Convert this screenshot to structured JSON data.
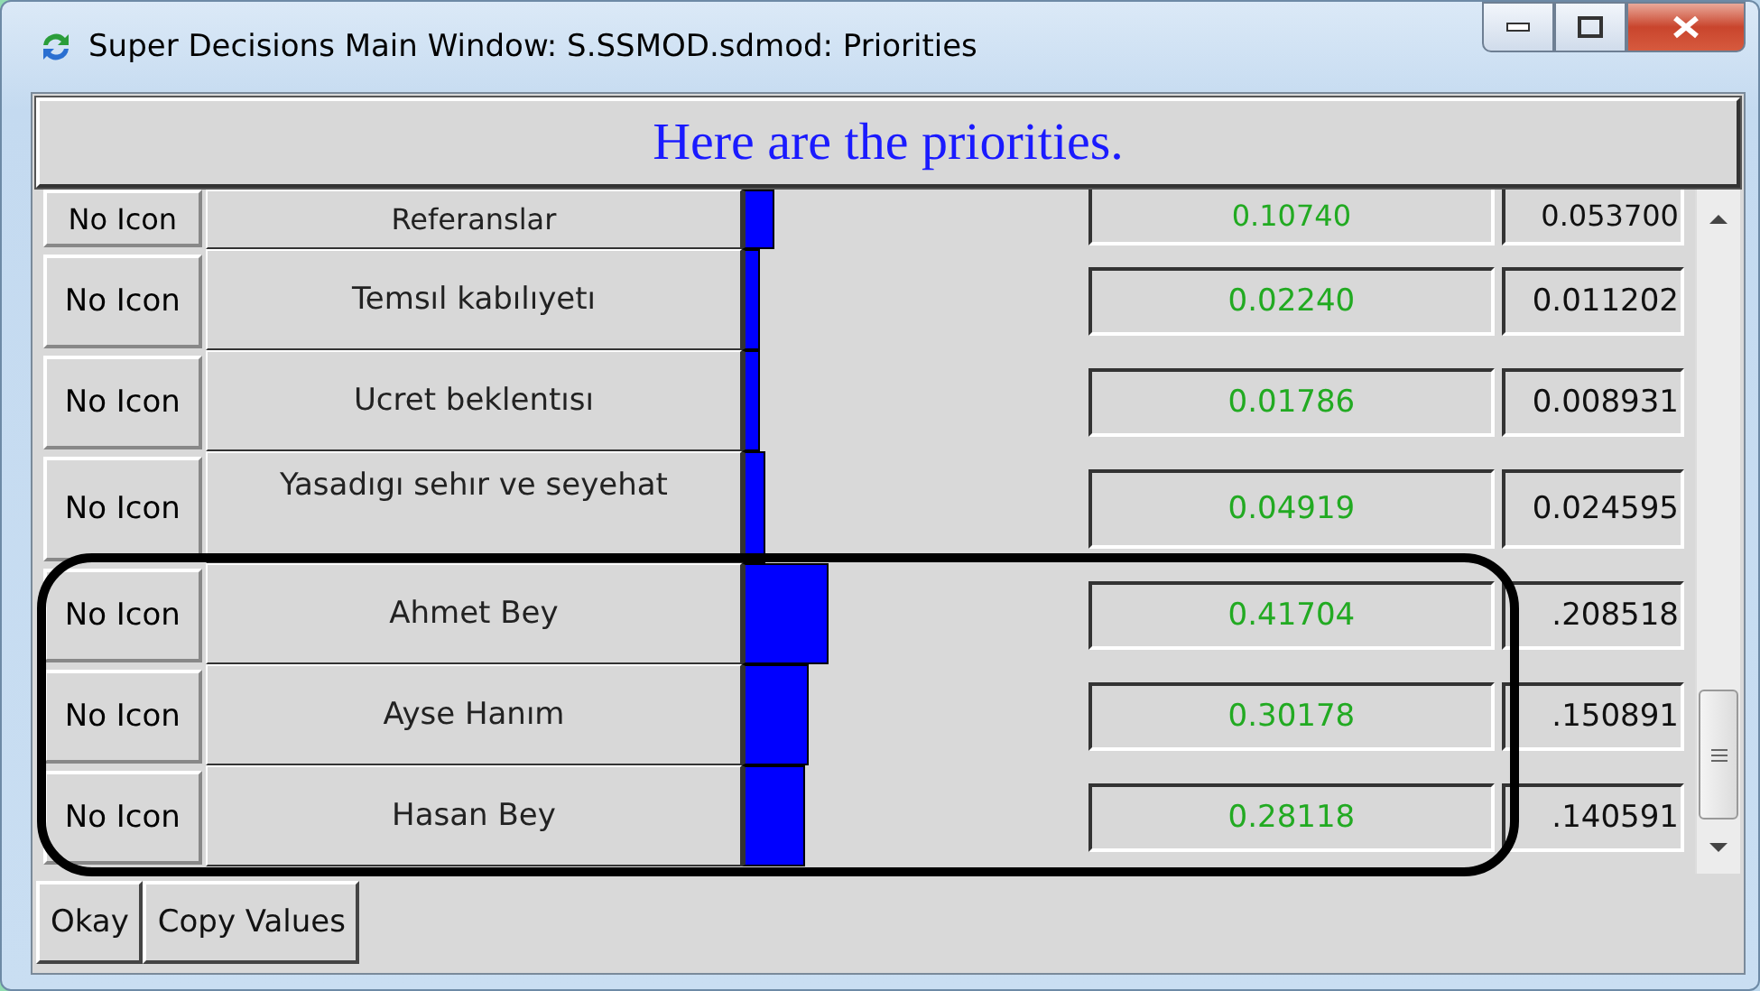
{
  "window": {
    "title": "Super Decisions Main Window: S.SSMOD.sdmod: Priorities"
  },
  "header": "Here are the priorities.",
  "rows": [
    {
      "icon": "No Icon",
      "name": "Referanslar",
      "value": "0.10740",
      "normalized": "0.053700"
    },
    {
      "icon": "No Icon",
      "name": "Temsıl kabılıyetı",
      "value": "0.02240",
      "normalized": "0.011202"
    },
    {
      "icon": "No Icon",
      "name": "Ucret beklentısı",
      "value": "0.01786",
      "normalized": "0.008931"
    },
    {
      "icon": "No Icon",
      "name": "Yasadıgı sehır ve seyehat",
      "value": "0.04919",
      "normalized": "0.024595"
    },
    {
      "icon": "No Icon",
      "name": "Ahmet Bey",
      "value": "0.41704",
      "normalized": ".208518"
    },
    {
      "icon": "No Icon",
      "name": "Ayse Hanım",
      "value": "0.30178",
      "normalized": ".150891"
    },
    {
      "icon": "No Icon",
      "name": "Hasan Bey",
      "value": "0.28118",
      "normalized": ".140591"
    }
  ],
  "buttons": [
    "Okay",
    "Copy Values"
  ]
}
